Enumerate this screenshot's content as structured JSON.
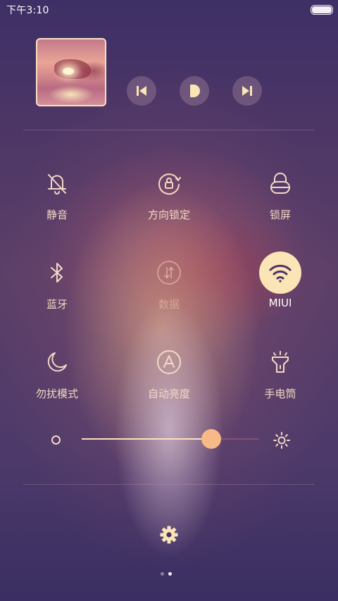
{
  "status_bar": {
    "time": "下午3:10",
    "battery_level": 1.0
  },
  "media": {
    "prev_icon": "skip-previous-icon",
    "play_icon": "play-icon",
    "next_icon": "skip-next-icon"
  },
  "toggles": [
    {
      "label": "静音",
      "icon": "bell-off-icon",
      "active": false,
      "enabled": true
    },
    {
      "label": "方向锁定",
      "icon": "rotation-lock-icon",
      "active": false,
      "enabled": true
    },
    {
      "label": "锁屏",
      "icon": "lock-icon",
      "active": false,
      "enabled": true
    },
    {
      "label": "蓝牙",
      "icon": "bluetooth-icon",
      "active": false,
      "enabled": true
    },
    {
      "label": "数据",
      "icon": "mobile-data-icon",
      "active": false,
      "enabled": false
    },
    {
      "label": "MIUI",
      "icon": "wifi-icon",
      "active": true,
      "enabled": true
    },
    {
      "label": "勿扰模式",
      "icon": "moon-icon",
      "active": false,
      "enabled": true
    },
    {
      "label": "自动亮度",
      "icon": "auto-brightness-icon",
      "active": false,
      "enabled": true
    },
    {
      "label": "手电筒",
      "icon": "flashlight-icon",
      "active": false,
      "enabled": true
    }
  ],
  "brightness": {
    "level": 0.73
  },
  "pager": {
    "page_count": 2,
    "current_page": 2
  },
  "colors": {
    "accent": "#fbe4b5",
    "icon": "#f3d9c4",
    "slider_thumb": "#f7b987"
  }
}
